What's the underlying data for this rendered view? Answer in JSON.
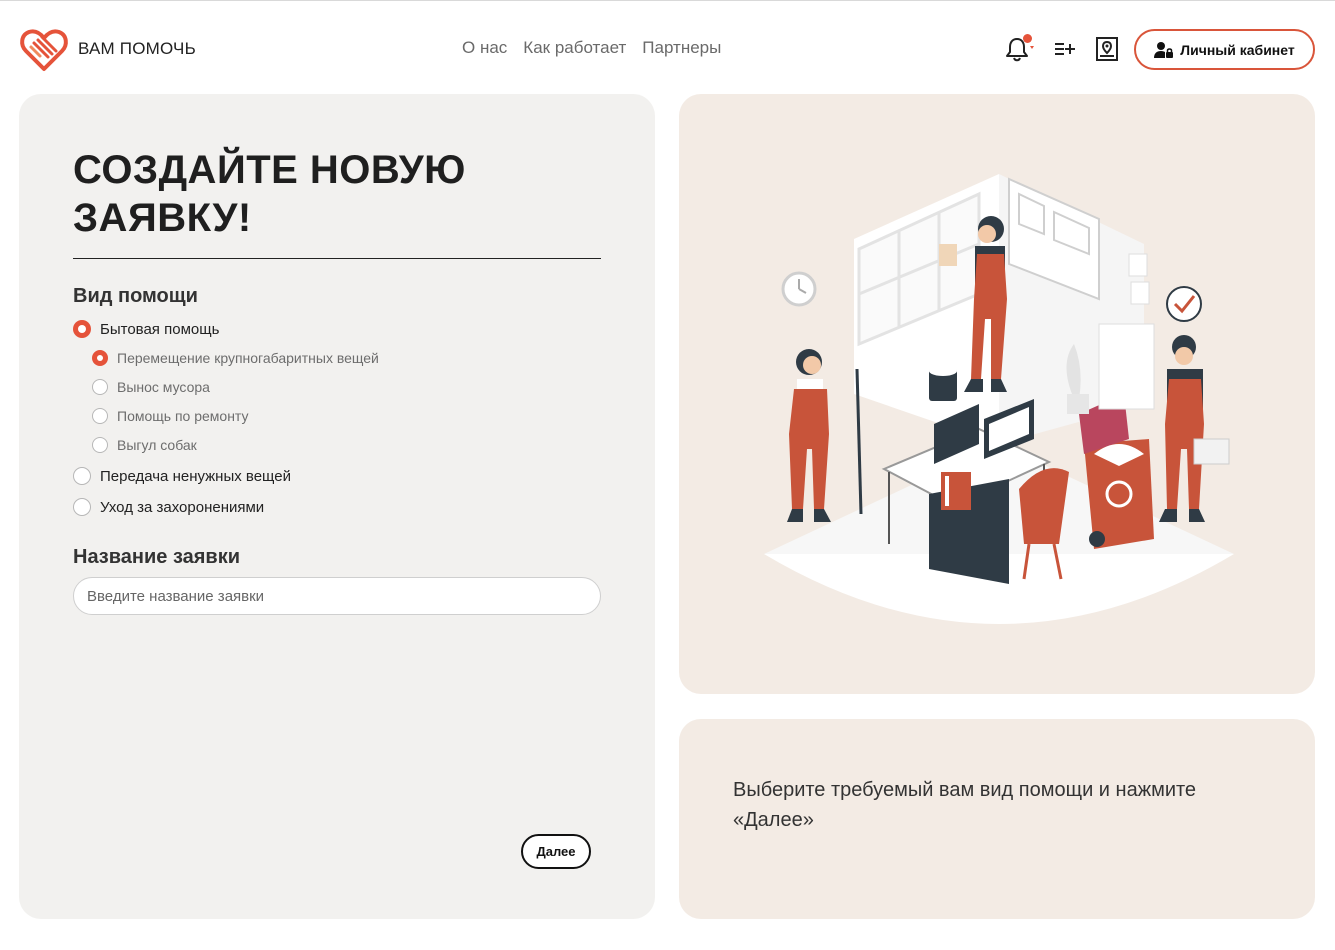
{
  "header": {
    "logo_text": "ВАМ ПОМОЧЬ",
    "nav": [
      "О нас",
      "Как работает",
      "Партнеры"
    ],
    "cabinet_button": "Личный кабинет"
  },
  "form": {
    "title": "СОЗДАЙТЕ НОВУЮ ЗАЯВКУ!",
    "help_type_heading": "Вид помощи",
    "options": [
      {
        "label": "Бытовая помощь",
        "selected": true
      },
      {
        "label": "Перемещение крупногабаритных вещей",
        "selected": true
      },
      {
        "label": "Вынос мусора",
        "selected": false
      },
      {
        "label": "Помощь по ремонту",
        "selected": false
      },
      {
        "label": "Выгул собак",
        "selected": false
      },
      {
        "label": "Передача ненужных вещей",
        "selected": false
      },
      {
        "label": "Уход за захоронениями",
        "selected": false
      }
    ],
    "name_heading": "Название заявки",
    "name_placeholder": "Введите название заявки",
    "name_value": "",
    "next_button": "Далее"
  },
  "hint": {
    "text": "Выберите требуемый вам вид помощи и нажмите «Далее»"
  },
  "colors": {
    "accent": "#e5533a",
    "card_gray": "#f2f1ef",
    "card_beige": "#f3ebe4"
  }
}
